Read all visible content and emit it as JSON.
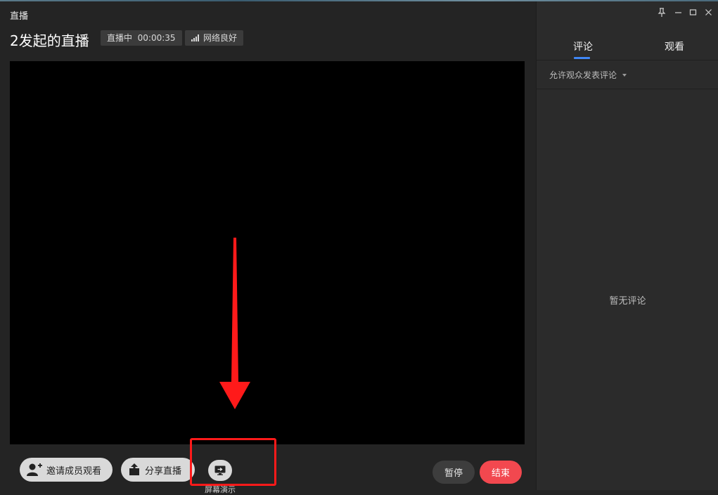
{
  "window": {
    "title": "直播"
  },
  "live": {
    "title": "2发起的直播",
    "status": "直播中",
    "duration": "00:00:35",
    "network": "网络良好"
  },
  "toolbar": {
    "invite_label": "邀请成员观看",
    "share_label": "分享直播",
    "screen_label": "屏幕演示",
    "pause_label": "暂停",
    "end_label": "结束"
  },
  "panel": {
    "tabs": [
      {
        "label": "评论",
        "active": true
      },
      {
        "label": "观看",
        "active": false
      }
    ],
    "filter_label": "允许观众发表评论",
    "empty_text": "暂无评论"
  },
  "colors": {
    "accent": "#3f86f5",
    "end_button": "#f2484f",
    "annotation": "#ff1a1a"
  },
  "icons": [
    "signal-icon",
    "add-user-icon",
    "share-icon",
    "screen-share-icon",
    "pin-icon",
    "minimize-icon",
    "maximize-icon",
    "close-icon",
    "dropdown-caret-icon"
  ]
}
